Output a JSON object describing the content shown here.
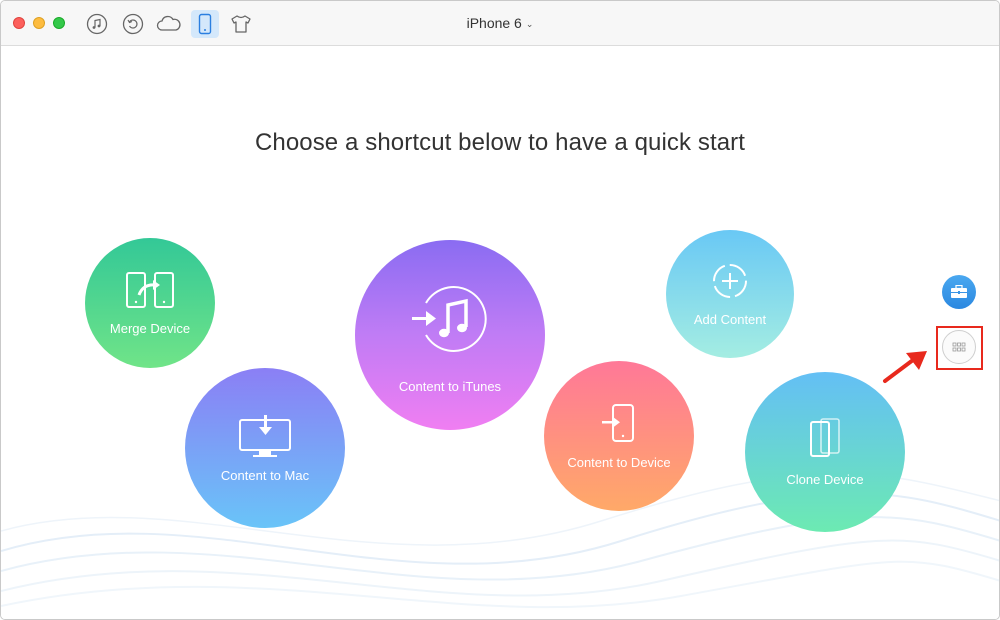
{
  "titlebar": {
    "device_name": "iPhone 6",
    "caret_icon": "chevron-down-icon",
    "toolbar_icons": [
      "music-icon",
      "backup-icon",
      "cloud-icon",
      "device-icon",
      "shirt-icon"
    ],
    "active_tool": "device-icon"
  },
  "main": {
    "heading": "Choose a shortcut below to have a quick start",
    "shortcuts": [
      {
        "label": "Merge Device",
        "icon": "merge-device-icon"
      },
      {
        "label": "Content to Mac",
        "icon": "content-to-mac-icon"
      },
      {
        "label": "Content to iTunes",
        "icon": "content-to-itunes-icon"
      },
      {
        "label": "Content to Device",
        "icon": "content-to-device-icon"
      },
      {
        "label": "Add Content",
        "icon": "add-content-icon"
      },
      {
        "label": "Clone Device",
        "icon": "clone-device-icon"
      }
    ]
  },
  "side": {
    "toolbox_icon": "toolbox-icon",
    "more_icon": "grid-icon"
  },
  "colors": {
    "highlight": "#e8291d",
    "accent": "#2b88e0"
  }
}
